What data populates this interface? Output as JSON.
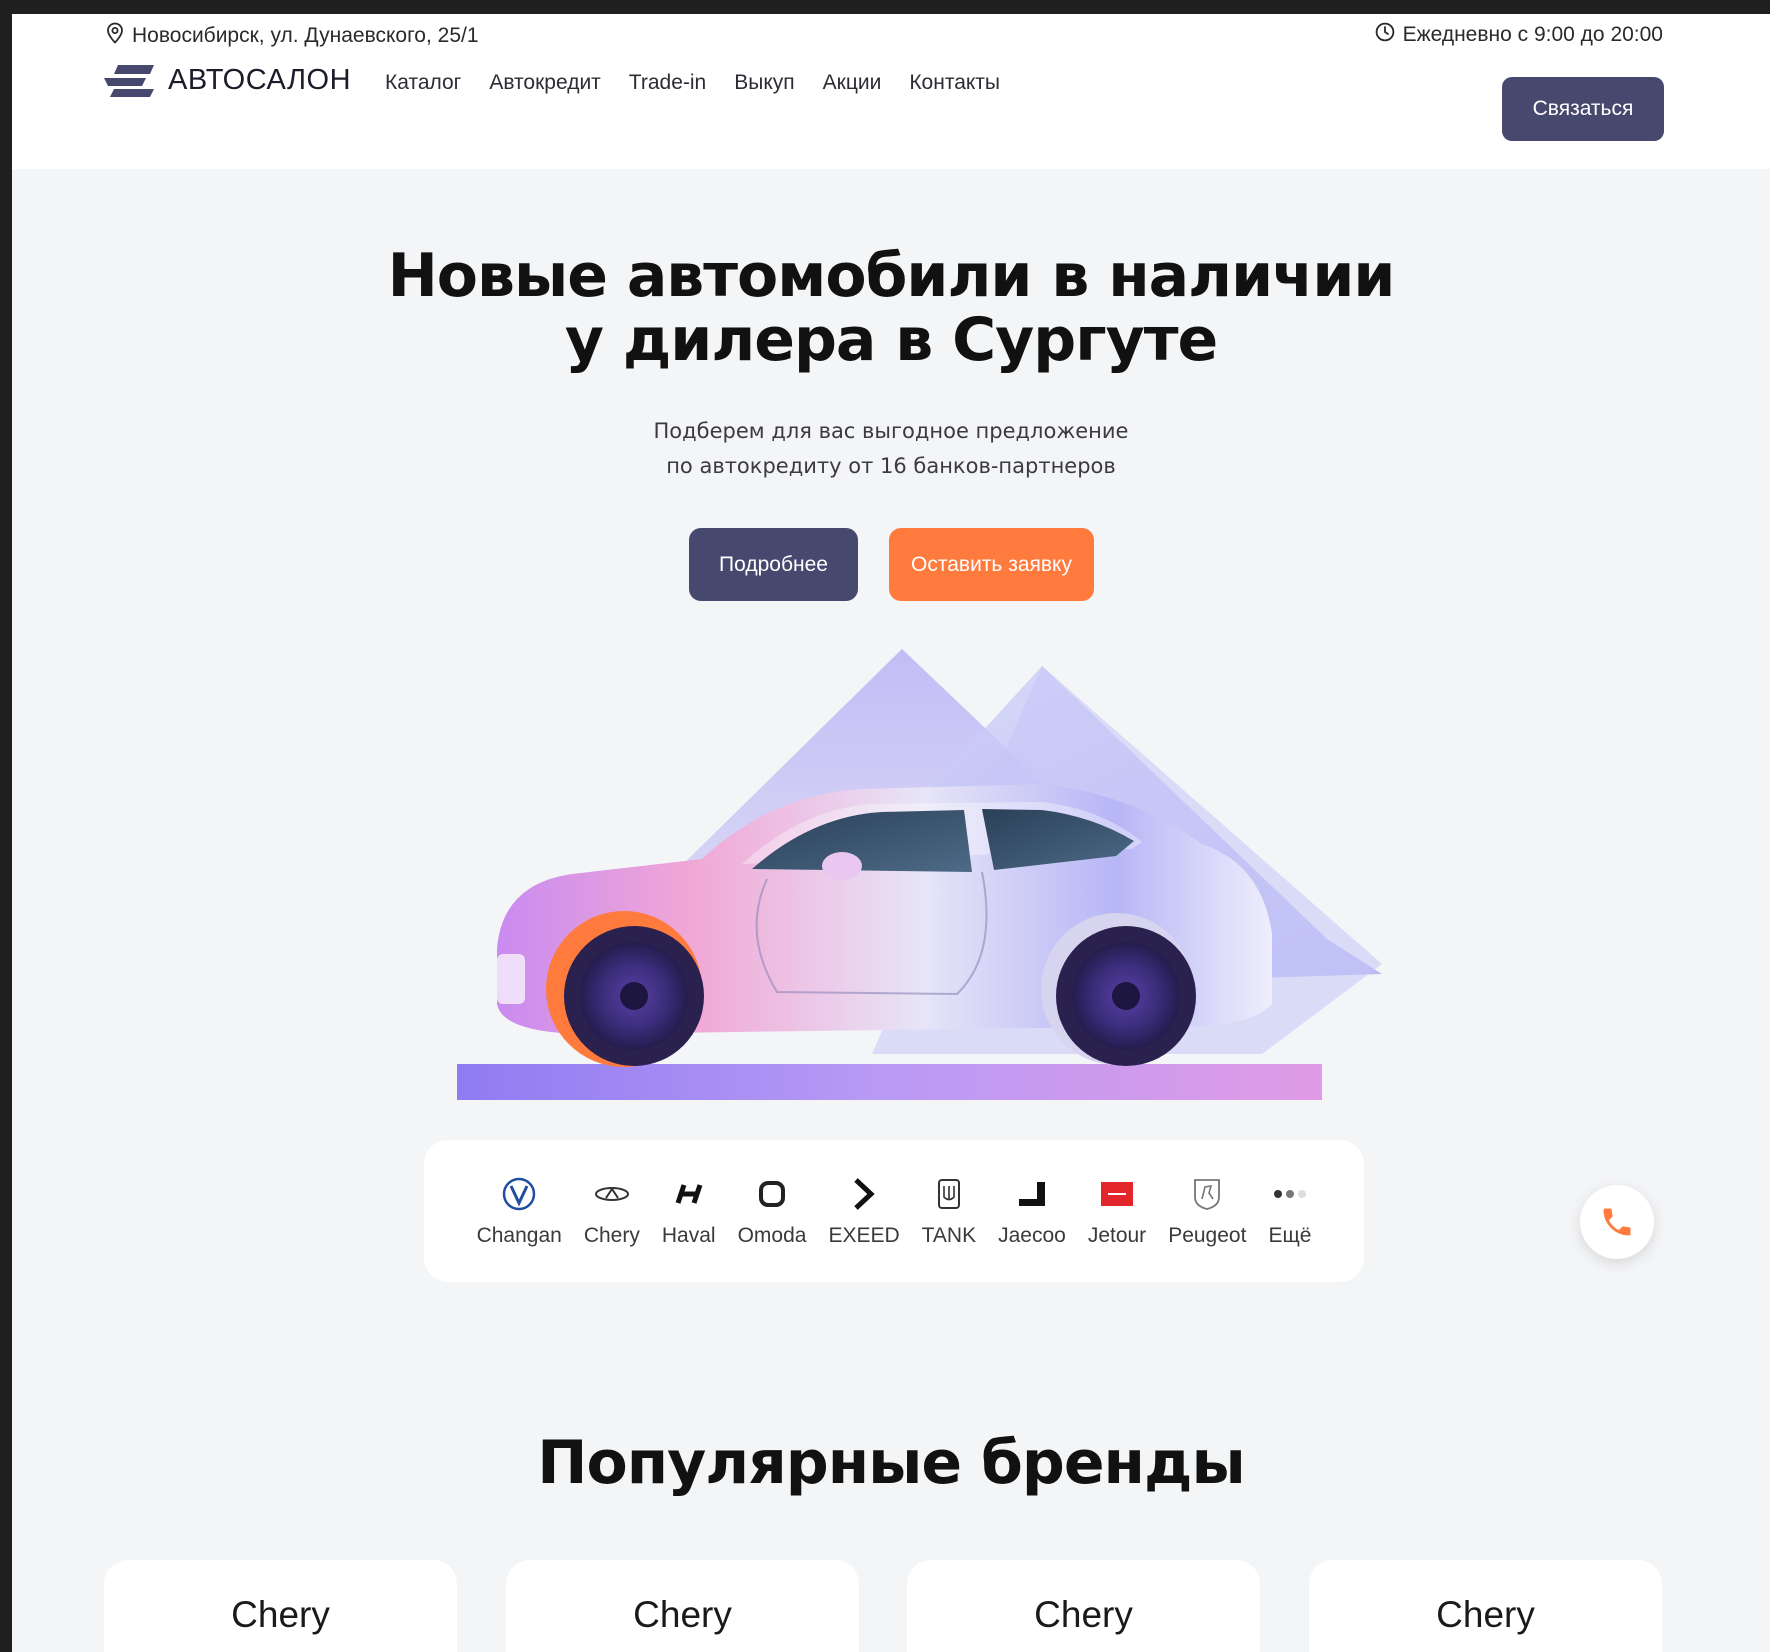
{
  "topbar": {
    "address": "Новосибирск, ул. Дунаевского, 25/1",
    "hours": "Ежедневно с 9:00 до 20:00",
    "address_icon": "location-pin-icon",
    "hours_icon": "clock-icon"
  },
  "header": {
    "logo_text": "АВТОСАЛОН",
    "nav": [
      "Каталог",
      "Автокредит",
      "Trade-in",
      "Выкуп",
      "Акции",
      "Контакты"
    ],
    "contact_button": "Связаться"
  },
  "hero": {
    "title_line1": "Новые автомобили в наличии",
    "title_line2": "у дилера в Сургуте",
    "subtitle_line1": "Подберем для вас выгодное предложение",
    "subtitle_line2": "по автокредиту от 16 банков-партнеров",
    "button_more": "Подробнее",
    "button_apply": "Оставить заявку"
  },
  "brands": [
    {
      "name": "Changan",
      "icon": "changan-logo-icon"
    },
    {
      "name": "Chery",
      "icon": "chery-logo-icon"
    },
    {
      "name": "Haval",
      "icon": "haval-logo-icon"
    },
    {
      "name": "Omoda",
      "icon": "omoda-logo-icon"
    },
    {
      "name": "EXEED",
      "icon": "exeed-logo-icon"
    },
    {
      "name": "TANK",
      "icon": "tank-logo-icon"
    },
    {
      "name": "Jaecoo",
      "icon": "jaecoo-logo-icon"
    },
    {
      "name": "Jetour",
      "icon": "jetour-logo-icon"
    },
    {
      "name": "Peugeot",
      "icon": "peugeot-logo-icon"
    },
    {
      "name": "Ещё",
      "icon": "more-dots-icon"
    }
  ],
  "popular": {
    "title": "Популярные бренды",
    "cards": [
      "Chery",
      "Chery",
      "Chery",
      "Chery"
    ]
  },
  "colors": {
    "primary": "#47486d",
    "accent": "#ff7a3d",
    "background": "#f4f5f7"
  }
}
